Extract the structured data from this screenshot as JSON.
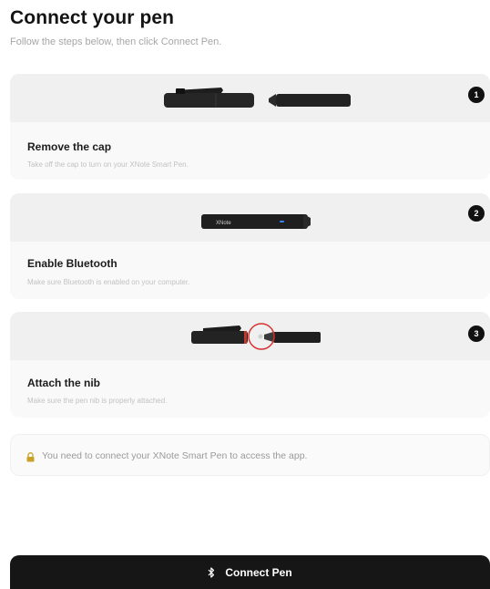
{
  "header": {
    "title": "Connect your pen",
    "subtitle": "Follow the steps below, then click Connect Pen."
  },
  "steps": [
    {
      "number": "1",
      "title": "Remove the cap",
      "description": "Take off the cap to turn on your XNote Smart Pen."
    },
    {
      "number": "2",
      "title": "Enable Bluetooth",
      "description": "Make sure Bluetooth is enabled on your computer.",
      "pen_brand": "XNote"
    },
    {
      "number": "3",
      "title": "Attach the nib",
      "description": "Make sure the pen nib is properly attached."
    }
  ],
  "notice": {
    "icon": "lock-icon",
    "text": "You need to connect your XNote Smart Pen to access the app."
  },
  "cta": {
    "icon": "bluetooth-icon",
    "label": "Connect Pen"
  },
  "colors": {
    "button_bg": "#161616",
    "highlight_circle": "#d93030",
    "lock_color": "#c9a227"
  }
}
